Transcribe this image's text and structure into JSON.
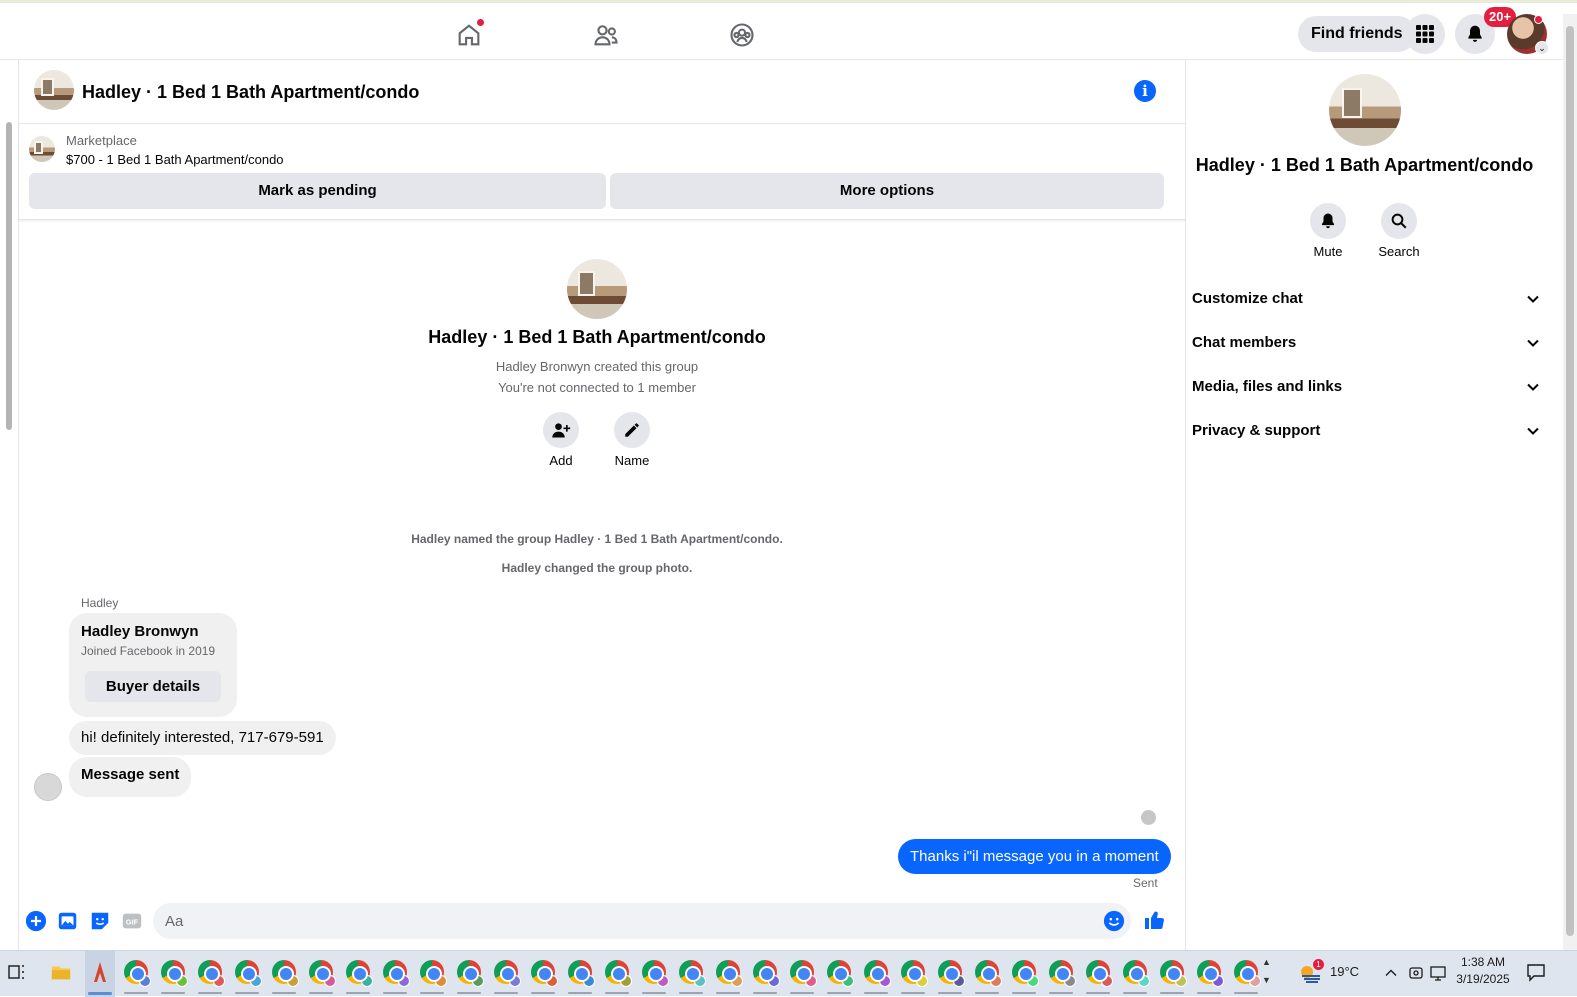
{
  "topnav": {
    "find_friends_label": "Find friends",
    "notifications_badge": "20+",
    "icons": [
      "home-icon",
      "friends-icon",
      "groups-icon",
      "menu-grid-icon",
      "bell-icon"
    ]
  },
  "chat": {
    "header_title": "Hadley · 1 Bed 1 Bath Apartment/condo",
    "listing": {
      "source": "Marketplace",
      "title": "$700 - 1 Bed 1 Bath Apartment/condo",
      "mark_pending_label": "Mark as pending",
      "more_options_label": "More options"
    },
    "intro": {
      "title": "Hadley · 1 Bed 1 Bath Apartment/condo",
      "created_by": "Hadley Bronwyn created this group",
      "connection": "You're not connected to 1 member",
      "add_label": "Add",
      "name_label": "Name"
    },
    "system_messages": [
      "Hadley named the group Hadley · 1 Bed 1 Bath Apartment/condo.",
      "Hadley changed the group photo."
    ],
    "sender_name": "Hadley",
    "buyer_card": {
      "name": "Hadley Bronwyn",
      "joined": "Joined Facebook in 2019",
      "button_label": "Buyer details"
    },
    "incoming_messages": [
      "hi! definitely interested, 717-679-591",
      "Message sent"
    ],
    "outgoing_message": "Thanks i\"il message you in a moment",
    "sent_status": "Sent",
    "composer_placeholder": "Aa"
  },
  "info_panel": {
    "title": "Hadley · 1 Bed 1 Bath Apartment/condo",
    "mute_label": "Mute",
    "search_label": "Search",
    "sections": [
      "Customize chat",
      "Chat members",
      "Media, files and links",
      "Privacy & support"
    ]
  },
  "taskbar": {
    "temperature": "19°C",
    "time": "1:38 AM",
    "date": "3/19/2025",
    "weather_badge": "1"
  },
  "colors": {
    "accent": "#0866ff",
    "badge_red": "#e41e3f",
    "button_grey": "#e4e6eb",
    "bubble_grey": "#f0f0f0"
  }
}
